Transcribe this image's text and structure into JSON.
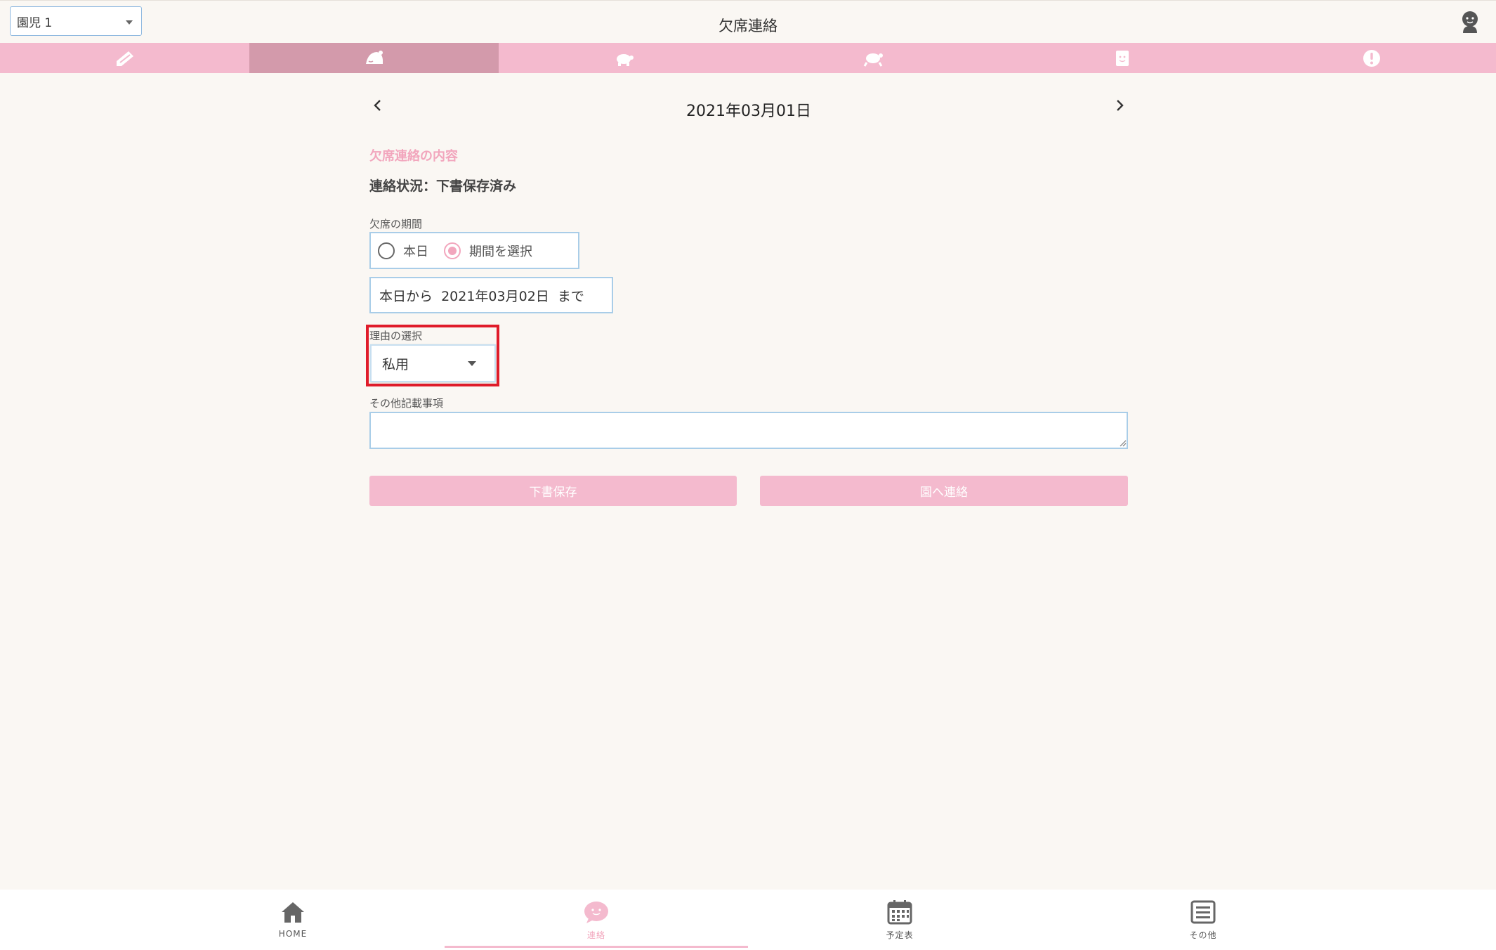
{
  "header": {
    "child_select_value": "園児 1",
    "title": "欠席連絡",
    "avatar_icon": "user-avatar-icon"
  },
  "tabs": [
    {
      "icon": "pencil-note-icon",
      "active": false
    },
    {
      "icon": "sleeping-cap-icon",
      "active": true
    },
    {
      "icon": "turtle-icon",
      "active": false
    },
    {
      "icon": "turtle-run-icon",
      "active": false
    },
    {
      "icon": "face-card-icon",
      "active": false
    },
    {
      "icon": "alert-icon",
      "active": false
    }
  ],
  "date_nav": {
    "date": "2021年03月01日",
    "prev_icon": "chevron-left-icon",
    "next_icon": "chevron-right-icon"
  },
  "form": {
    "section_title": "欠席連絡の内容",
    "status": "連絡状況：下書保存済み",
    "period_label": "欠席の期間",
    "radio_today": "本日",
    "radio_range": "期間を選択",
    "period_text": "本日から  2021年03月02日  まで",
    "reason_label": "理由の選択",
    "reason_value": "私用",
    "notes_label": "その他記載事項",
    "notes_value": ""
  },
  "buttons": {
    "draft": "下書保存",
    "send": "園へ連絡"
  },
  "bottom_nav": [
    {
      "label": "HOME",
      "icon": "home-icon"
    },
    {
      "label": "連絡",
      "icon": "chat-bubble-icon"
    },
    {
      "label": "予定表",
      "icon": "calendar-icon"
    },
    {
      "label": "その他",
      "icon": "menu-list-icon"
    }
  ],
  "colors": {
    "accent_pink": "#f4bace",
    "active_tab": "#d39aab",
    "highlight_red": "#e01c2a",
    "background": "#faf7f3"
  }
}
